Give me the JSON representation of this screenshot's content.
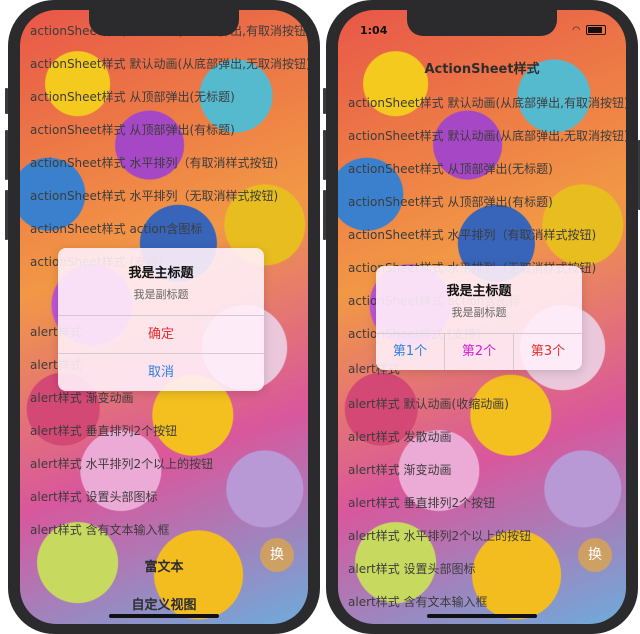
{
  "colors": {
    "red": "#e03030",
    "blue": "#2f7fe0",
    "magenta": "#d020d0",
    "pink_overlay": "#fff0fa"
  },
  "left": {
    "list": [
      "actionSheet样式 默认动画(从底部弹出,有取消按钮)",
      "actionSheet样式 默认动画(从底部弹出,无取消按钮)",
      "actionSheet样式 从顶部弹出(无标题)",
      "actionSheet样式 从顶部弹出(有标题)",
      "actionSheet样式 水平排列（有取消样式按钮)",
      "actionSheet样式 水平排列（无取消样式按钮)",
      "actionSheet样式 action含图标",
      "actionSheet样式 (支持)",
      "alert样式",
      "alert样式",
      "alert样式 渐变动画",
      "alert样式 垂直排列2个按钮",
      "alert样式 水平排列2个以上的按钮",
      "alert样式 设置头部图标",
      "alert样式 含有文本输入框",
      "富文本",
      "自定义视图"
    ],
    "alert": {
      "title": "我是主标题",
      "subtitle": "我是副标题",
      "confirm": "确定",
      "cancel": "取消"
    },
    "huan": "换"
  },
  "right": {
    "time": "1:04",
    "title": "ActionSheet样式",
    "list": [
      "actionSheet样式 默认动画(从底部弹出,有取消按钮)",
      "actionSheet样式 默认动画(从底部弹出,无取消按钮)",
      "actionSheet样式 从顶部弹出(无标题)",
      "actionSheet样式 从顶部弹出(有标题)",
      "actionSheet样式 水平排列（有取消样式按钮)",
      "actionSheet样式 水平排列（无取消样式按钮)",
      "actionSheet样式 action含图标",
      "actionSheet样式 (支持)",
      "alert样式",
      "alert样式 默认动画(收缩动画)",
      "alert样式 发散动画",
      "alert样式 渐变动画",
      "alert样式 垂直排列2个按钮",
      "alert样式 水平排列2个以上的按钮",
      "alert样式 设置头部图标",
      "alert样式 含有文本输入框"
    ],
    "alert": {
      "title": "我是主标题",
      "subtitle": "我是副标题",
      "btn1": "第1个",
      "btn2": "第2个",
      "btn3": "第3个"
    },
    "huan": "换"
  }
}
